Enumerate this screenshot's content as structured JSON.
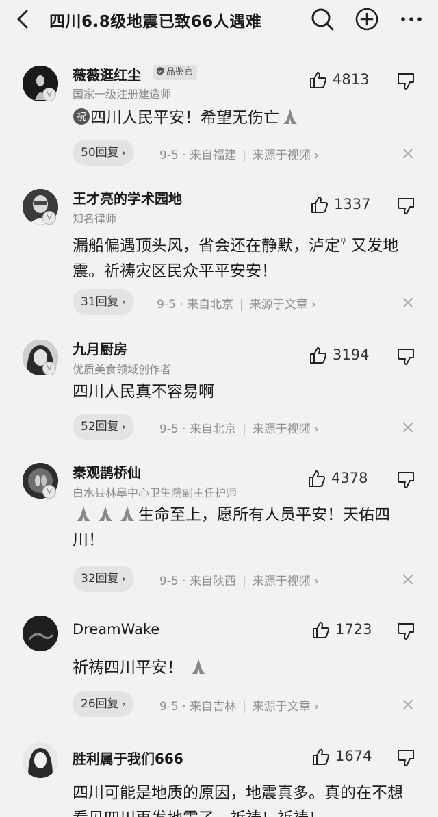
{
  "header": {
    "title": "四川6.8级地震已致66人遇难",
    "icons": [
      "back-icon",
      "search-icon",
      "add-icon",
      "more-icon"
    ]
  },
  "comments": [
    {
      "username": "薇薇逛红尘",
      "badge": "品鉴官",
      "user_title": "国家一级注册建造师",
      "likes": "4813",
      "badge_prefix": "祝",
      "content": "四川人民平安！希望无伤亡",
      "replies": "50回复",
      "date": "9-5",
      "location": "来自福建",
      "source": "来源于视频"
    },
    {
      "username": "王才亮的学术园地",
      "user_title": "知名律师",
      "likes": "1337",
      "content_a": "漏船偏遇顶头风，省会还在静默，泸定",
      "content_b": "又发地震。祈祷灾区民众平平安安！",
      "replies": "31回复",
      "date": "9-5",
      "location": "来自北京",
      "source": "来源于文章"
    },
    {
      "username": "九月厨房",
      "user_title": "优质美食领域创作者",
      "likes": "3194",
      "content": "四川人民真不容易啊",
      "replies": "52回复",
      "date": "9-5",
      "location": "来自北京",
      "source": "来源于视频"
    },
    {
      "username": "秦观鹊桥仙",
      "user_title": "白水县林皋中心卫生院副主任护师",
      "likes": "4378",
      "content": "生命至上，愿所有人员平安！天佑四川！",
      "replies": "32回复",
      "date": "9-5",
      "location": "来自陕西",
      "source": "来源于视频"
    },
    {
      "username": "DreamWake",
      "likes": "1723",
      "content": "祈祷四川平安！",
      "replies": "26回复",
      "date": "9-5",
      "location": "来自吉林",
      "source": "来源于文章"
    },
    {
      "username": "胜利属于我们666",
      "likes": "1674",
      "content": "四川可能是地质的原因，地震真多。真的在不想看见四川再发地震了，祈祷！祈祷！"
    }
  ],
  "colors": {
    "background": "#f2f2f2",
    "text": "#1c1c1c",
    "muted": "#8e8e8e",
    "pill": "#e3e3e3"
  }
}
